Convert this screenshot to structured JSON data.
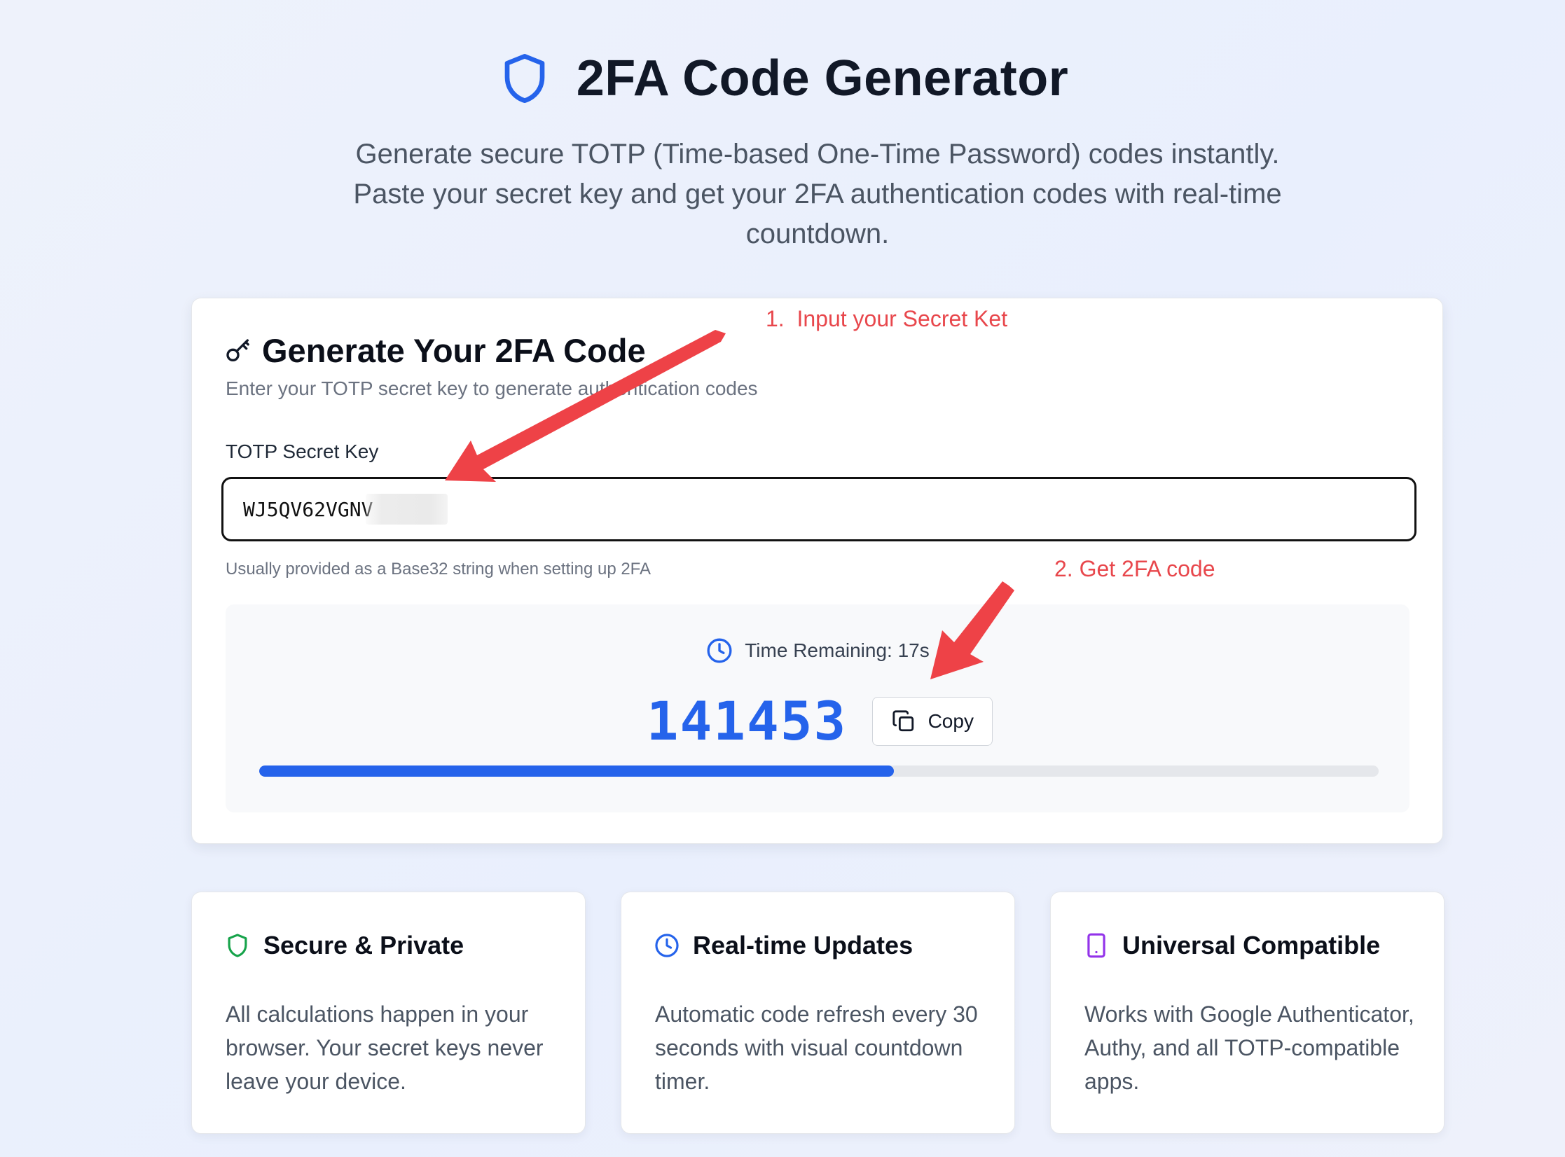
{
  "header": {
    "title": "2FA Code Generator",
    "subtitle": "Generate secure TOTP (Time-based One-Time Password) codes instantly. Paste your secret key and get your 2FA authentication codes with real-time countdown."
  },
  "generator": {
    "title": "Generate Your 2FA Code",
    "subtitle": "Enter your TOTP secret key to generate authentication codes",
    "field_label": "TOTP Secret Key",
    "secret_value": "WJ5QV62VGNV",
    "hint": "Usually provided as a Base32 string when setting up 2FA",
    "timer_text": "Time Remaining: 17s",
    "code": "141453",
    "copy_label": "Copy",
    "progress_fraction": 0.567
  },
  "annotations": {
    "step1": "1.  Input your Secret Ket",
    "step2": "2. Get 2FA code",
    "color": "#e8474c"
  },
  "features": [
    {
      "title": "Secure & Private",
      "description": "All calculations happen in your browser. Your secret keys never leave your device.",
      "icon": "shield-icon",
      "icon_color": "#16a34a"
    },
    {
      "title": "Real-time Updates",
      "description": "Automatic code refresh every 30 seconds with visual countdown timer.",
      "icon": "clock-icon",
      "icon_color": "#2563eb"
    },
    {
      "title": "Universal Compatible",
      "description": "Works with Google Authenticator, Authy, and all TOTP-compatible apps.",
      "icon": "smartphone-icon",
      "icon_color": "#9333ea"
    }
  ],
  "colors": {
    "accent": "#2563eb",
    "title_text": "#111827",
    "muted_text": "#4b5563"
  }
}
